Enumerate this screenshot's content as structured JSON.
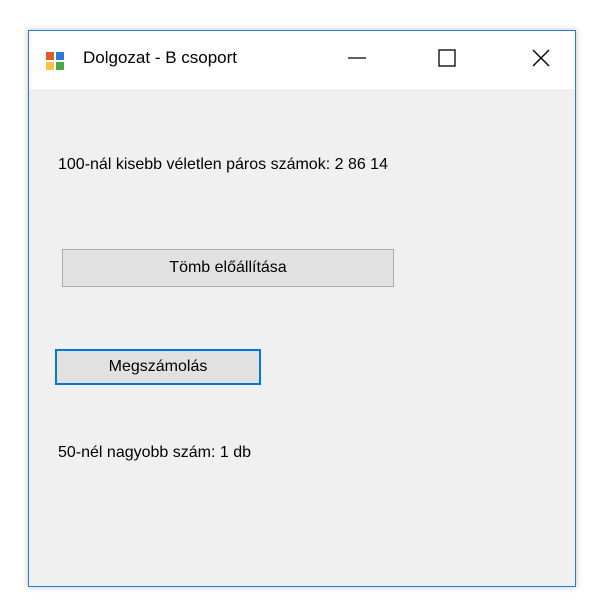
{
  "window": {
    "title": "Dolgozat - B csoport",
    "icon": "windows-forms-app-icon",
    "caption_buttons": [
      "minimize-icon",
      "maximize-icon",
      "close-icon"
    ]
  },
  "form": {
    "random_label": "100-nál kisebb véletlen páros számok: 2 86 14",
    "generate_button_label": "Tömb előállítása",
    "count_button_label": "Megszámolás",
    "count_label": "50-nél nagyobb szám: 1 db"
  },
  "colors": {
    "accent_border": "#0078d7",
    "window_background": "#f0f0f0",
    "button_face": "#e1e1e1"
  }
}
